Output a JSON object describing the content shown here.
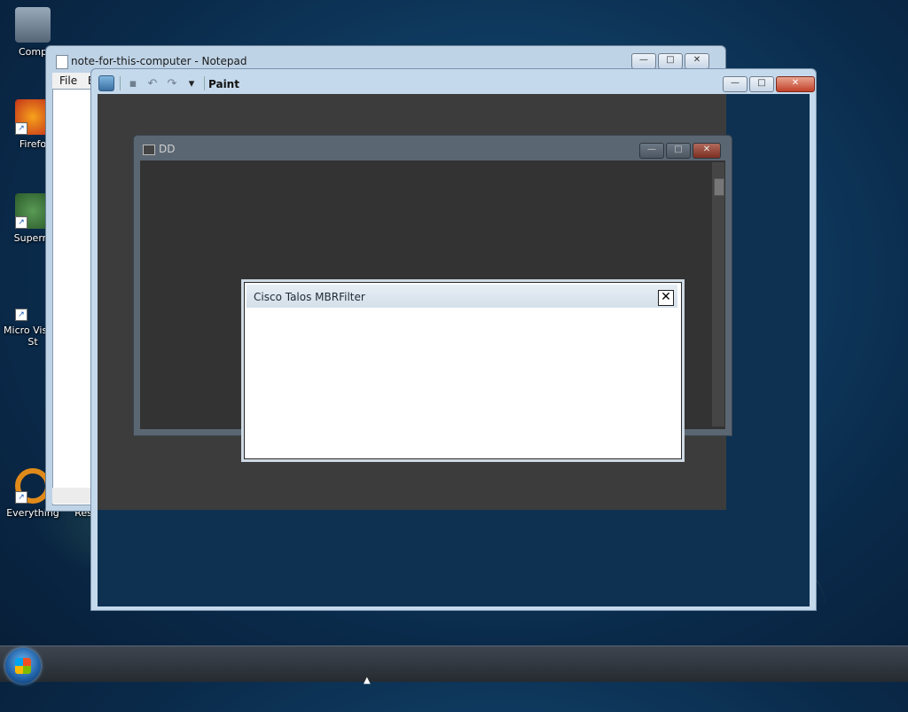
{
  "desktop": {
    "icons": [
      {
        "label": "Comp"
      },
      {
        "label": "Firefo"
      },
      {
        "label": "Superm"
      },
      {
        "label": "Micro Visual St"
      },
      {
        "label": "Everything"
      },
      {
        "label": "Resume-Zip"
      }
    ]
  },
  "notepad": {
    "title": "note-for-this-computer - Notepad",
    "menu": [
      "File",
      "E"
    ]
  },
  "paint": {
    "title": "Paint"
  },
  "inner_window": {
    "title": "DD"
  },
  "dialog": {
    "title": "Cisco Talos MBRFilter",
    "close_label": "✕"
  },
  "caption": {
    "minimize": "—",
    "maximize": "□",
    "close": "✕"
  }
}
